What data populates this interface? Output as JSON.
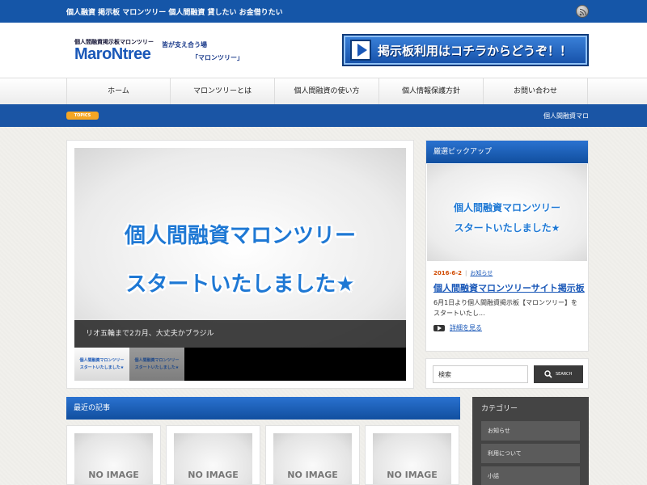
{
  "topbar": {
    "tagline": "個人融資 掲示板 マロンツリー 個人間融資 貸したい お金借りたい",
    "rss_icon": "rss-icon"
  },
  "header": {
    "logo_sub": "個人間融資掲示板マロンツリー",
    "logo_main": "MaroNtree",
    "catch_line1": "皆が支え合う場",
    "catch_line2": "「マロンツリー」",
    "banner_text": "掲示板利用はコチラからどうぞ！！"
  },
  "nav": {
    "items": [
      {
        "label": "ホーム"
      },
      {
        "label": "マロンツリーとは"
      },
      {
        "label": "個人間融資の使い方"
      },
      {
        "label": "個人情報保護方針"
      },
      {
        "label": "お問い合わせ"
      }
    ]
  },
  "topics": {
    "badge": "TOPICS",
    "text": "個人間融資マロ"
  },
  "slider": {
    "line1": "個人間融資マロンツリー",
    "line2": "スタートいたしました★",
    "caption": "リオ五輪まで2カ月、大丈夫かブラジル",
    "thumbs": [
      {
        "line1": "個人間融資マロンツリー",
        "line2": "スタートいたしました★"
      },
      {
        "line1": "個人間融資マロンツリー",
        "line2": "スタートいたしました★"
      }
    ]
  },
  "pickup": {
    "heading": "厳選ピックアップ",
    "image_line1": "個人間融資マロンツリー",
    "image_line2": "スタートいたしました★",
    "date": "2016-6-2",
    "separator": "|",
    "category": "お知らせ",
    "title": "個人間融資マロンツリーサイト掲示板",
    "excerpt": "6月1日より個人間融資掲示板【マロンツリー】をスタートいたし...",
    "more_link": "詳細を見る"
  },
  "search": {
    "value": "検索",
    "button_label": "SEARCH"
  },
  "recent": {
    "heading": "最近の記事",
    "cards": [
      {
        "placeholder": "NO IMAGE"
      },
      {
        "placeholder": "NO IMAGE"
      },
      {
        "placeholder": "NO IMAGE"
      },
      {
        "placeholder": "NO IMAGE"
      }
    ]
  },
  "category": {
    "heading": "カテゴリー",
    "items": [
      {
        "label": "お知らせ"
      },
      {
        "label": "利用について"
      },
      {
        "label": "小話"
      }
    ]
  },
  "colors": {
    "brand_blue": "#1a55a5",
    "accent_orange": "#f5a623",
    "date_red": "#d04a00"
  }
}
